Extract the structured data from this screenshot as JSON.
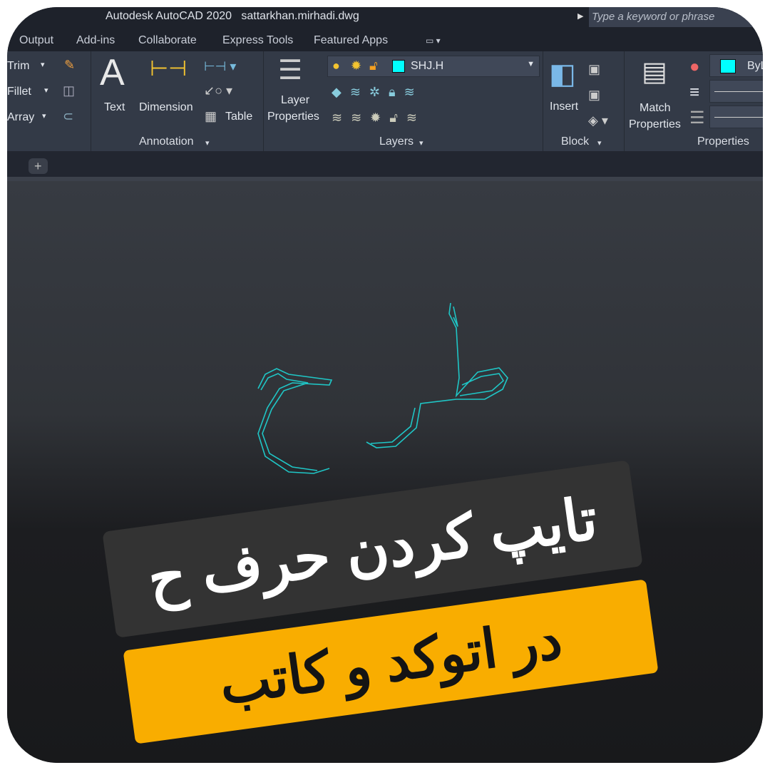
{
  "titlebar": {
    "title": "Autodesk AutoCAD 2020   sattarkhan.mirhadi.dwg",
    "search_placeholder": "Type a keyword or phrase"
  },
  "tabs": [
    "Output",
    "Add-ins",
    "Collaborate",
    "Express Tools",
    "Featured Apps"
  ],
  "ribbon": {
    "modify": {
      "trim": "Trim",
      "fillet": "Fillet",
      "array": "Array"
    },
    "annotation": {
      "text": "Text",
      "dimension": "Dimension",
      "table": "Table",
      "label": "Annotation"
    },
    "layers": {
      "layer_properties_1": "Layer",
      "layer_properties_2": "Properties",
      "current_layer": "SHJ.H",
      "label": "Layers"
    },
    "block": {
      "insert": "Insert",
      "label": "Block"
    },
    "properties": {
      "match_1": "Match",
      "match_2": "Properties",
      "color": "ByL",
      "label": "Properties"
    }
  },
  "colors": {
    "layer_color": "#00ffff",
    "drawing": "#1fc6c6",
    "banner_dark": "#333333",
    "banner_yellow": "#f9ad00"
  },
  "banner": {
    "line1": "تایپ کردن حرف ح",
    "line2": "در اتوکد و کاتب"
  }
}
